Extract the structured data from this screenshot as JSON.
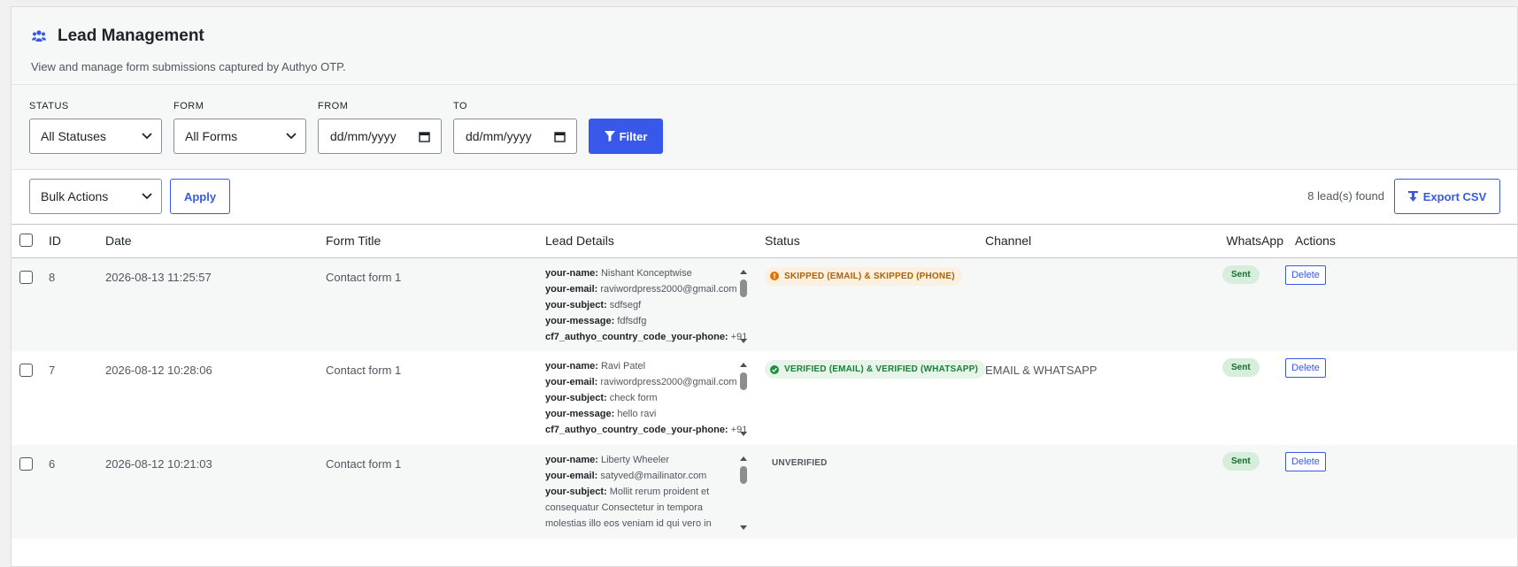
{
  "header": {
    "title": "Lead Management",
    "subtitle": "View and manage form submissions captured by Authyo OTP."
  },
  "filters": {
    "status_label": "STATUS",
    "status_value": "All Statuses",
    "form_label": "FORM",
    "form_value": "All Forms",
    "from_label": "FROM",
    "from_value": "dd/mm/yyyy",
    "to_label": "TO",
    "to_value": "dd/mm/yyyy",
    "filter_button": "Filter"
  },
  "toolbar": {
    "bulk_value": "Bulk Actions",
    "apply_button": "Apply",
    "lead_count": "8 lead(s) found",
    "export_button": "Export CSV"
  },
  "table": {
    "columns": [
      "ID",
      "Date",
      "Form Title",
      "Lead Details",
      "Status",
      "Channel",
      "WhatsApp",
      "Actions"
    ],
    "rows": [
      {
        "id": "8",
        "date": "2026-08-13 11:25:57",
        "form": "Contact form 1",
        "details": [
          {
            "k": "your-name:",
            "v": " Nishant Konceptwise"
          },
          {
            "k": "your-email:",
            "v": " raviwordpress2000@gmail.com"
          },
          {
            "k": "your-subject:",
            "v": " sdfsegf"
          },
          {
            "k": "your-message:",
            "v": " fdfsdfg"
          },
          {
            "k": "cf7_authyo_country_code_your-phone:",
            "v": " +91"
          }
        ],
        "status": "SKIPPED (EMAIL) & SKIPPED (PHONE)",
        "status_kind": "warn",
        "channel": "",
        "whatsapp": "Sent",
        "action": "Delete"
      },
      {
        "id": "7",
        "date": "2026-08-12 10:28:06",
        "form": "Contact form 1",
        "details": [
          {
            "k": "your-name:",
            "v": " Ravi Patel"
          },
          {
            "k": "your-email:",
            "v": " raviwordpress2000@gmail.com"
          },
          {
            "k": "your-subject:",
            "v": " check form"
          },
          {
            "k": "your-message:",
            "v": " hello ravi"
          },
          {
            "k": "cf7_authyo_country_code_your-phone:",
            "v": " +91"
          }
        ],
        "status": "VERIFIED (EMAIL) & VERIFIED (WHATSAPP)",
        "status_kind": "ok",
        "channel": "EMAIL & WHATSAPP",
        "whatsapp": "Sent",
        "action": "Delete"
      },
      {
        "id": "6",
        "date": "2026-08-12 10:21:03",
        "form": "Contact form 1",
        "details": [
          {
            "k": "your-name:",
            "v": " Liberty Wheeler"
          },
          {
            "k": "your-email:",
            "v": " satyved@mailinator.com"
          },
          {
            "k": "your-subject:",
            "v": " Mollit rerum proident et consequatur Consectetur in tempora molestias illo eos veniam id qui vero in"
          }
        ],
        "status": "UNVERIFIED",
        "status_kind": "plain",
        "channel": "",
        "whatsapp": "Sent",
        "action": "Delete"
      }
    ]
  },
  "colors": {
    "primary": "#3858e9",
    "warn_bg": "#fcf0e1",
    "warn_text": "#b26200",
    "ok_bg": "#e6f4ea",
    "ok_text": "#1a7f37",
    "sent_bg": "#d7eedd"
  },
  "icons": {
    "title": "users-icon",
    "filter": "funnel-icon",
    "export": "download-icon",
    "select_arrow": "chevron-down-icon",
    "date": "calendar-icon"
  }
}
